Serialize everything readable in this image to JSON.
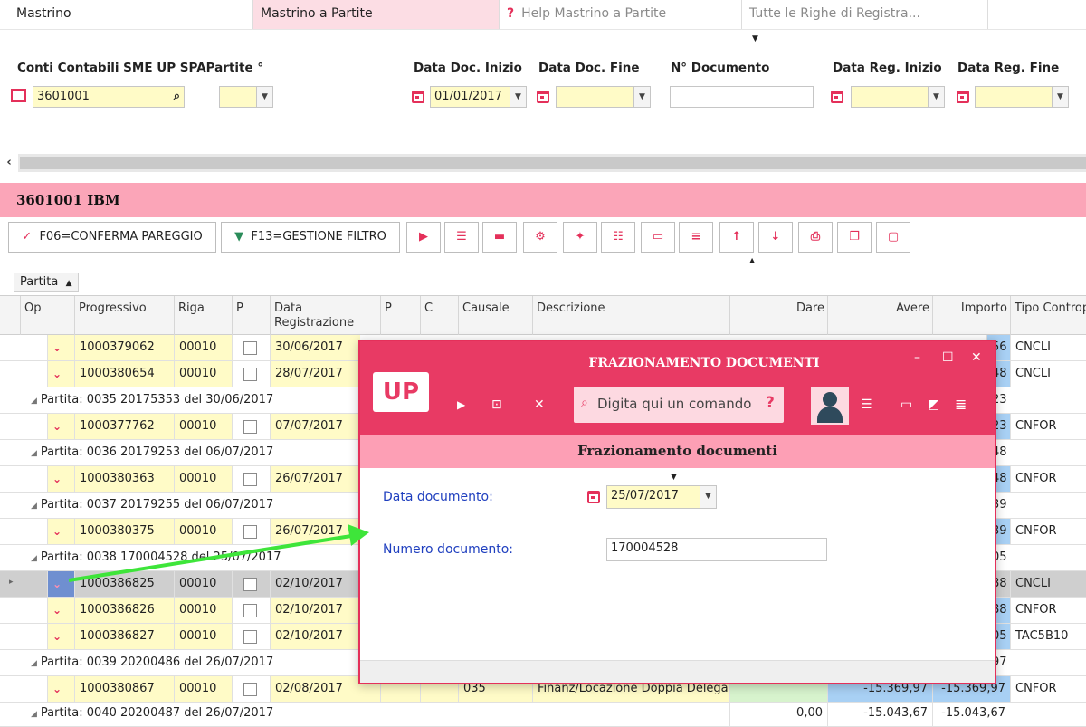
{
  "tabs": [
    "Mastrino",
    "Mastrino a Partite",
    "Help Mastrino a Partite",
    "Tutte le Righe di Registra..."
  ],
  "filters": {
    "conti_label": "Conti Contabili SME UP SPA",
    "partite_label": "Partite °",
    "conto_value": "3601001",
    "data_doc_inizio_label": "Data Doc. Inizio",
    "data_doc_inizio_value": "01/01/2017",
    "data_doc_fine_label": "Data Doc. Fine",
    "n_documento_label": "N° Documento",
    "data_reg_inizio_label": "Data Reg. Inizio",
    "data_reg_fine_label": "Data Reg. Fine"
  },
  "section_title": "3601001 IBM",
  "toolbar": {
    "confirm_label": "F06=CONFERMA PAREGGIO",
    "filter_label": "F13=GESTIONE FILTRO"
  },
  "grouping": "Partita",
  "columns": [
    "Op",
    "Progressivo",
    "Riga",
    "P",
    "Data Registrazione",
    "P",
    "C",
    "Causale",
    "Descrizione",
    "Dare",
    "Avere",
    "Importo",
    "Tipo Contropartita"
  ],
  "rows": [
    {
      "kind": "data",
      "progressivo": "1000379062",
      "riga": "00010",
      "data": "30/06/2017",
      "importo": "56",
      "tipo": "CNCLI"
    },
    {
      "kind": "data",
      "progressivo": "1000380654",
      "riga": "00010",
      "data": "28/07/2017",
      "importo": "48",
      "tipo": "CNCLI"
    },
    {
      "kind": "group",
      "label": "Partita: 0035 20175353 del 30/06/2017",
      "importo": "23"
    },
    {
      "kind": "data",
      "progressivo": "1000377762",
      "riga": "00010",
      "data": "07/07/2017",
      "importo": "23",
      "tipo": "CNFOR"
    },
    {
      "kind": "group",
      "label": "Partita: 0036 20179253 del 06/07/2017",
      "importo": "48"
    },
    {
      "kind": "data",
      "progressivo": "1000380363",
      "riga": "00010",
      "data": "26/07/2017",
      "importo": "48",
      "tipo": "CNFOR"
    },
    {
      "kind": "group",
      "label": "Partita: 0037 20179255 del 06/07/2017",
      "importo": "39"
    },
    {
      "kind": "data",
      "progressivo": "1000380375",
      "riga": "00010",
      "data": "26/07/2017",
      "importo": "39",
      "tipo": "CNFOR"
    },
    {
      "kind": "group",
      "label": "Partita: 0038 170004528 del 25/07/2017",
      "importo": "05"
    },
    {
      "kind": "selected",
      "progressivo": "1000386825",
      "riga": "00010",
      "data": "02/10/2017",
      "importo": "88",
      "tipo": "CNCLI"
    },
    {
      "kind": "data",
      "progressivo": "1000386826",
      "riga": "00010",
      "data": "02/10/2017",
      "importo": "88",
      "tipo": "CNFOR"
    },
    {
      "kind": "data",
      "progressivo": "1000386827",
      "riga": "00010",
      "data": "02/10/2017",
      "importo": "05",
      "tipo": "TAC5B10"
    },
    {
      "kind": "group",
      "label": "Partita: 0039 20200486 del 26/07/2017",
      "importo": "97"
    },
    {
      "kind": "data",
      "progressivo": "1000380867",
      "riga": "00010",
      "data": "02/08/2017",
      "causale": "035",
      "descrizione": "Finanz/Locazione Doppia Delega",
      "avere": "-15.369,97",
      "importo": "-15.369,97",
      "tipo": "CNFOR"
    },
    {
      "kind": "group",
      "label": "Partita: 0040 20200487 del 26/07/2017",
      "dare": "0,00",
      "avere": "-15.043,67",
      "importo": "-15.043,67"
    }
  ],
  "dialog": {
    "window_title": "FRAZIONAMENTO DOCUMENTI",
    "logo": "UP",
    "command_placeholder": "Digita qui un comando",
    "subtitle": "Frazionamento documenti",
    "data_documento_label": "Data documento:",
    "data_documento_value": "25/07/2017",
    "numero_documento_label": "Numero documento:",
    "numero_documento_value": "170004528"
  },
  "colors": {
    "accent": "#e83a64",
    "pink_band": "#fba5b8",
    "yellow_field": "#fffbc7",
    "arrow": "#3ee53a"
  }
}
